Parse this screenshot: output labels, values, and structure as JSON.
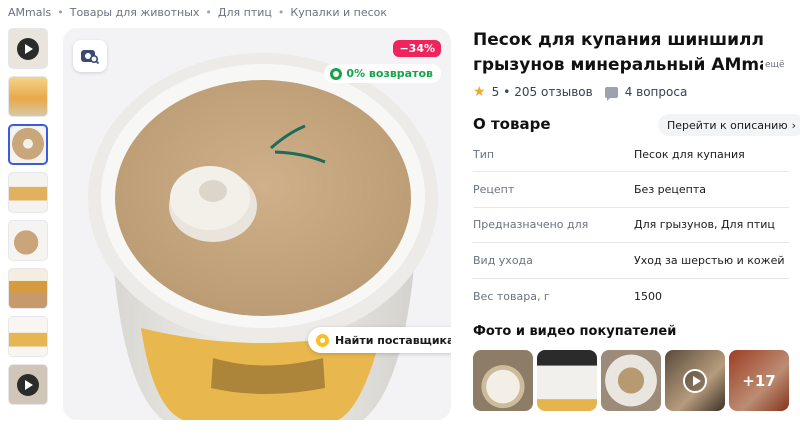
{
  "breadcrumb": [
    "AMmals",
    "Товары для животных",
    "Для птиц",
    "Купалки и песок"
  ],
  "badges": {
    "discount": "−34%",
    "returns": "0% возвратов"
  },
  "main_image": {
    "supplier_button": "Найти поставщика"
  },
  "product": {
    "title_line1": "Песок для купания шиншилл и",
    "title_line2": "грызунов минеральный AMmals",
    "more_link": "ещё"
  },
  "rating": {
    "score": "5",
    "reviews": "205 отзывов",
    "questions": "4 вопроса"
  },
  "about": {
    "title": "О товаре",
    "goto_label": "Перейти к описанию"
  },
  "specs": [
    {
      "key": "Тип",
      "value": "Песок для купания"
    },
    {
      "key": "Рецепт",
      "value": "Без рецепта"
    },
    {
      "key": "Предназначено для",
      "value": "Для грызунов, Для птиц"
    },
    {
      "key": "Вид ухода",
      "value": "Уход за шерстью и кожей"
    },
    {
      "key": "Вес товара, г",
      "value": "1500"
    }
  ],
  "photos": {
    "title": "Фото и видео покупателей",
    "more_count": "+17"
  },
  "colors": {
    "accent": "#3b5bdb",
    "discount": "#f0245c",
    "returns": "#16a34a",
    "star": "#f5a623"
  }
}
